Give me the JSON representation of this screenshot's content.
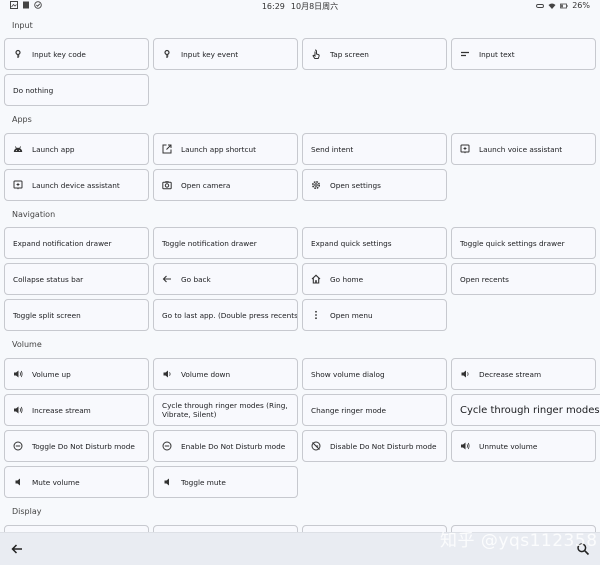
{
  "status_bar": {
    "time": "16:29",
    "date": "10月8日周六",
    "battery": "26%"
  },
  "sections": {
    "input": "Input",
    "apps": "Apps",
    "navigation": "Navigation",
    "volume": "Volume",
    "display": "Display"
  },
  "input": {
    "key_code": "Input key code",
    "key_event": "Input key event",
    "tap_screen": "Tap screen",
    "input_text": "Input text",
    "do_nothing": "Do nothing"
  },
  "apps": {
    "launch_app": "Launch app",
    "launch_shortcut": "Launch app shortcut",
    "send_intent": "Send intent",
    "voice_assistant": "Launch voice assistant",
    "device_assistant": "Launch device assistant",
    "open_camera": "Open camera",
    "open_settings": "Open settings"
  },
  "navigation": {
    "expand_notification": "Expand notification drawer",
    "toggle_notification": "Toggle notification drawer",
    "expand_quick": "Expand quick settings",
    "toggle_quick": "Toggle quick settings drawer",
    "collapse_status": "Collapse status bar",
    "go_back": "Go back",
    "go_home": "Go home",
    "open_recents": "Open recents",
    "split_screen": "Toggle split screen",
    "last_app": "Go to last app. (Double press recents)",
    "open_menu": "Open menu"
  },
  "volume": {
    "volume_up": "Volume up",
    "volume_down": "Volume down",
    "show_dialog": "Show volume dialog",
    "decrease_stream": "Decrease stream",
    "increase_stream": "Increase stream",
    "cycle_ringer_full": "Cycle through ringer modes (Ring, Vibrate, Silent)",
    "change_ringer": "Change ringer mode",
    "cycle_ringer_big": "Cycle through ringer modes (Ring, Vibrate, Silent)",
    "toggle_dnd": "Toggle Do Not Disturb mode",
    "enable_dnd": "Enable Do Not Disturb mode",
    "disable_dnd": "Disable Do Not Disturb mode",
    "unmute": "Unmute volume",
    "mute": "Mute volume",
    "toggle_mute": "Toggle mute"
  },
  "watermark": "知乎 @yqs112358",
  "icons": [
    "key-icon",
    "touch-icon",
    "text-icon",
    "android-icon",
    "launch-icon",
    "assistant-icon",
    "camera-icon",
    "settings-icon",
    "back-arrow-icon",
    "home-icon",
    "more-vert-icon",
    "volume-icon",
    "dnd-icon",
    "search-icon"
  ]
}
